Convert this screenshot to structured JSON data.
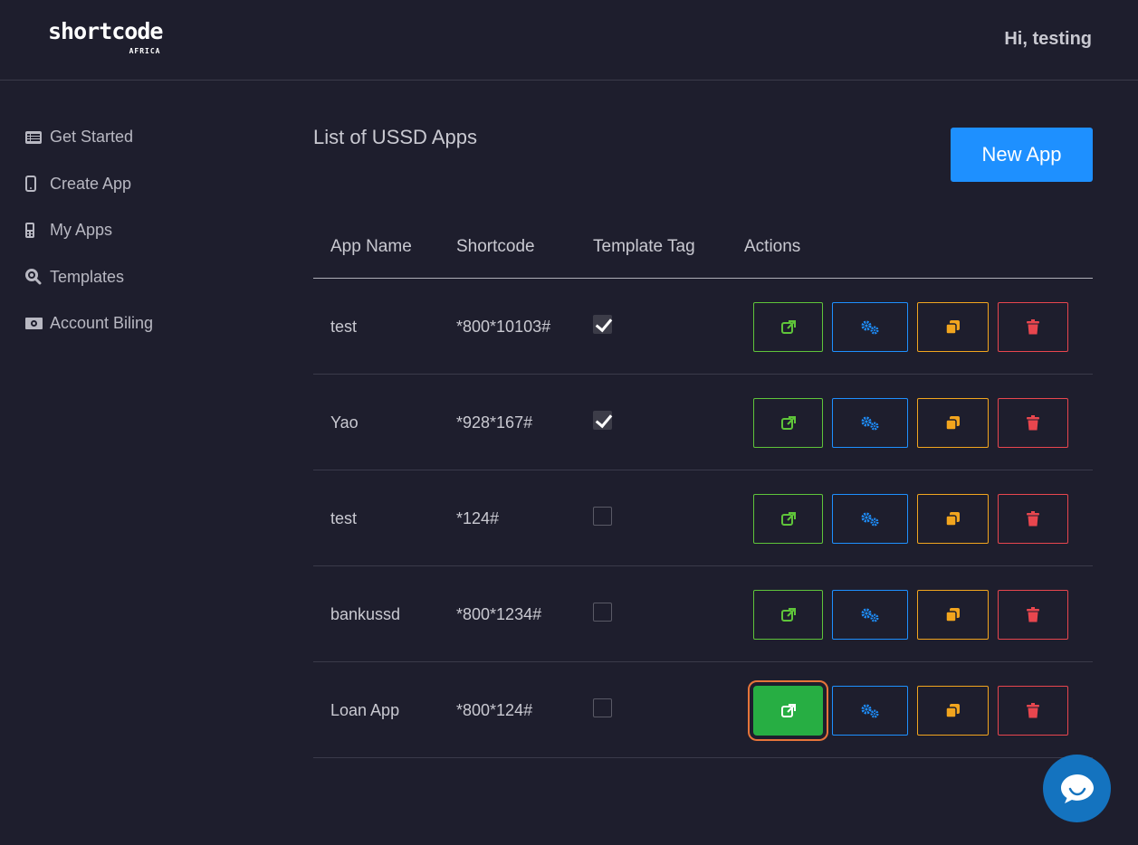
{
  "brand": {
    "logo_text": "shortcode",
    "logo_sub": "AFRICA"
  },
  "header": {
    "greeting": "Hi, testing"
  },
  "sidebar": {
    "items": [
      {
        "label": "Get Started",
        "icon": "list-icon"
      },
      {
        "label": "Create App",
        "icon": "mobile-icon"
      },
      {
        "label": "My Apps",
        "icon": "mobile-alt-icon"
      },
      {
        "label": "Templates",
        "icon": "search-icon"
      },
      {
        "label": "Account Biling",
        "icon": "money-icon"
      }
    ]
  },
  "main": {
    "title": "List of USSD Apps",
    "new_app_label": "New App",
    "columns": [
      "App Name",
      "Shortcode",
      "Template Tag",
      "Actions"
    ],
    "rows": [
      {
        "name": "test",
        "shortcode": "*800*10103#",
        "template": true
      },
      {
        "name": "Yao",
        "shortcode": "*928*167#",
        "template": true
      },
      {
        "name": "test",
        "shortcode": "*124#",
        "template": false
      },
      {
        "name": "bankussd",
        "shortcode": "*800*1234#",
        "template": false
      },
      {
        "name": "Loan App",
        "shortcode": "*800*124#",
        "template": false
      }
    ],
    "actions": [
      "open-external",
      "settings",
      "copy",
      "delete"
    ],
    "focused_action": {
      "row": 5,
      "action": "open-external"
    }
  },
  "colors": {
    "background": "#1e1e2d",
    "primary": "#1e90ff",
    "open": "#5fc43a",
    "open_active": "#27ae43",
    "copy": "#f2a51e",
    "delete": "#e8464e",
    "focus_ring": "#e6743a",
    "chat": "#1473bf"
  },
  "chat_widget": {
    "icon": "chat-bubble-icon"
  }
}
